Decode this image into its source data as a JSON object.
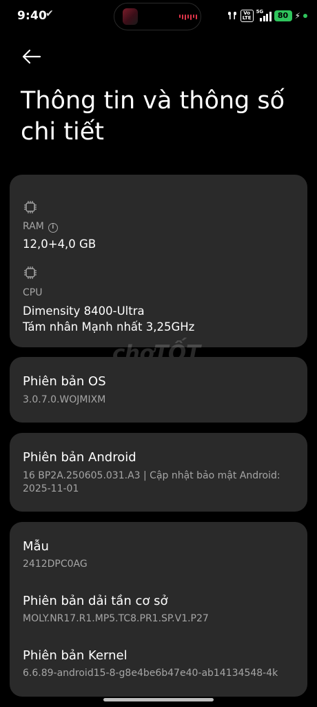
{
  "status_bar": {
    "time": "9:40",
    "network_label": "5G",
    "volte_label": "Vo\nLTE",
    "battery": "80"
  },
  "page": {
    "title": "Thông tin và thông số chi tiết"
  },
  "hardware": {
    "ram_label": "RAM",
    "ram_value": "12,0+4,0 GB",
    "cpu_label": "CPU",
    "cpu_model": "Dimensity 8400-Ultra",
    "cpu_detail": "Tám nhân Mạnh nhất 3,25GHz"
  },
  "os_version": {
    "title": "Phiên bản OS",
    "value": "3.0.7.0.WOJMIXM"
  },
  "android_version": {
    "title": "Phiên bản Android",
    "value": "16 BP2A.250605.031.A3 | Cập nhật bảo mật Android: 2025-11-01"
  },
  "device_info": {
    "model_title": "Mẫu",
    "model_value": "2412DPC0AG",
    "baseband_title": "Phiên bản dải tần cơ sở",
    "baseband_value": "MOLY.NR17.R1.MP5.TC8.PR1.SP.V1.P27",
    "kernel_title": "Phiên bản Kernel",
    "kernel_value": "6.6.89-android15-8-g8e4be6b47e40-ab14134548-4k"
  },
  "watermark": "chợTỐT",
  "colors": {
    "background": "#000000",
    "card": "#2a2a2a",
    "secondary_text": "#a6a6a6",
    "battery": "#2fc45c"
  }
}
